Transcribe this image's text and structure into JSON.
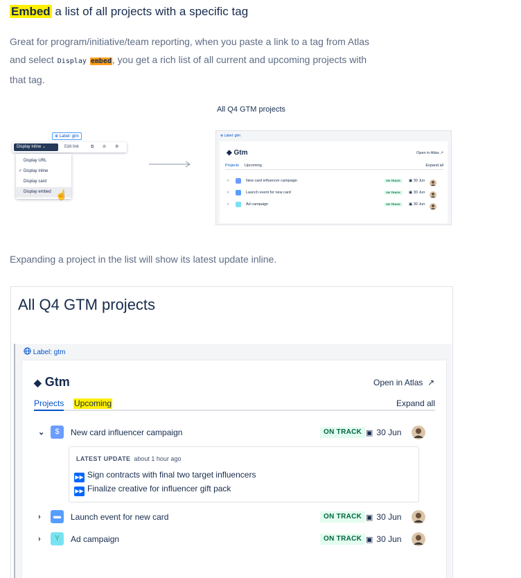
{
  "heading": {
    "highlight": "Embed",
    "rest": " a list of all projects with a specific tag"
  },
  "intro": {
    "line1": "Great for program/initiative/team reporting, when you paste a link to a tag from Atlas",
    "line2_pre": "and select ",
    "code1": "Display",
    "code2": "embed",
    "line2_post": ", you get a rich list of all current and upcoming projects with",
    "line3": "that tag."
  },
  "small_figure": {
    "title": "All Q4 GTM projects",
    "menu": {
      "label_chip": "Label: gtm",
      "display_button": "Display inline",
      "edit_link": "Edit link",
      "options": [
        "Display URL",
        "Display inline",
        "Display card",
        "Display embed"
      ],
      "checked_index": 1,
      "hovered_index": 3
    },
    "embed": {
      "label": "Label: gtm",
      "title": "Gtm",
      "open_link": "Open in Atlas",
      "tabs": [
        "Projects",
        "Upcoming"
      ],
      "expand": "Expand all",
      "projects": [
        {
          "name": "New card influencer campaign",
          "status": "ON TRACK",
          "date": "30 Jun",
          "color": "#6b9cff"
        },
        {
          "name": "Launch event for new card",
          "status": "ON TRACK",
          "date": "30 Jun",
          "color": "#579dff"
        },
        {
          "name": "Ad campaign",
          "status": "ON TRACK",
          "date": "30 Jun",
          "color": "#79e2f2"
        }
      ]
    }
  },
  "caption2": "Expanding a project in the list will show its latest update inline.",
  "big_figure": {
    "title": "All Q4 GTM projects",
    "label": "Label: gtm",
    "gtm": "Gtm",
    "open_link": "Open in Atlas",
    "tabs": {
      "projects": "Projects",
      "upcoming": "Upcoming"
    },
    "expand": "Expand all",
    "projects": [
      {
        "name": "New card influencer campaign",
        "status": "ON TRACK",
        "date": "30 Jun",
        "expanded": true
      },
      {
        "name": "Launch event for new card",
        "status": "ON TRACK",
        "date": "30 Jun",
        "expanded": false
      },
      {
        "name": "Ad campaign",
        "status": "ON TRACK",
        "date": "30 Jun",
        "expanded": false
      }
    ],
    "update": {
      "label": "LATEST UPDATE",
      "time": "about 1 hour ago",
      "items": [
        "Sign contracts with final two target influencers",
        "Finalize creative for influencer gift pack"
      ]
    }
  },
  "colors": {
    "accent": "#0052cc",
    "status_bg": "#e3fcef",
    "status_text": "#006644",
    "highlight_yellow": "#fff000",
    "highlight_orange": "#ff9f1a"
  }
}
